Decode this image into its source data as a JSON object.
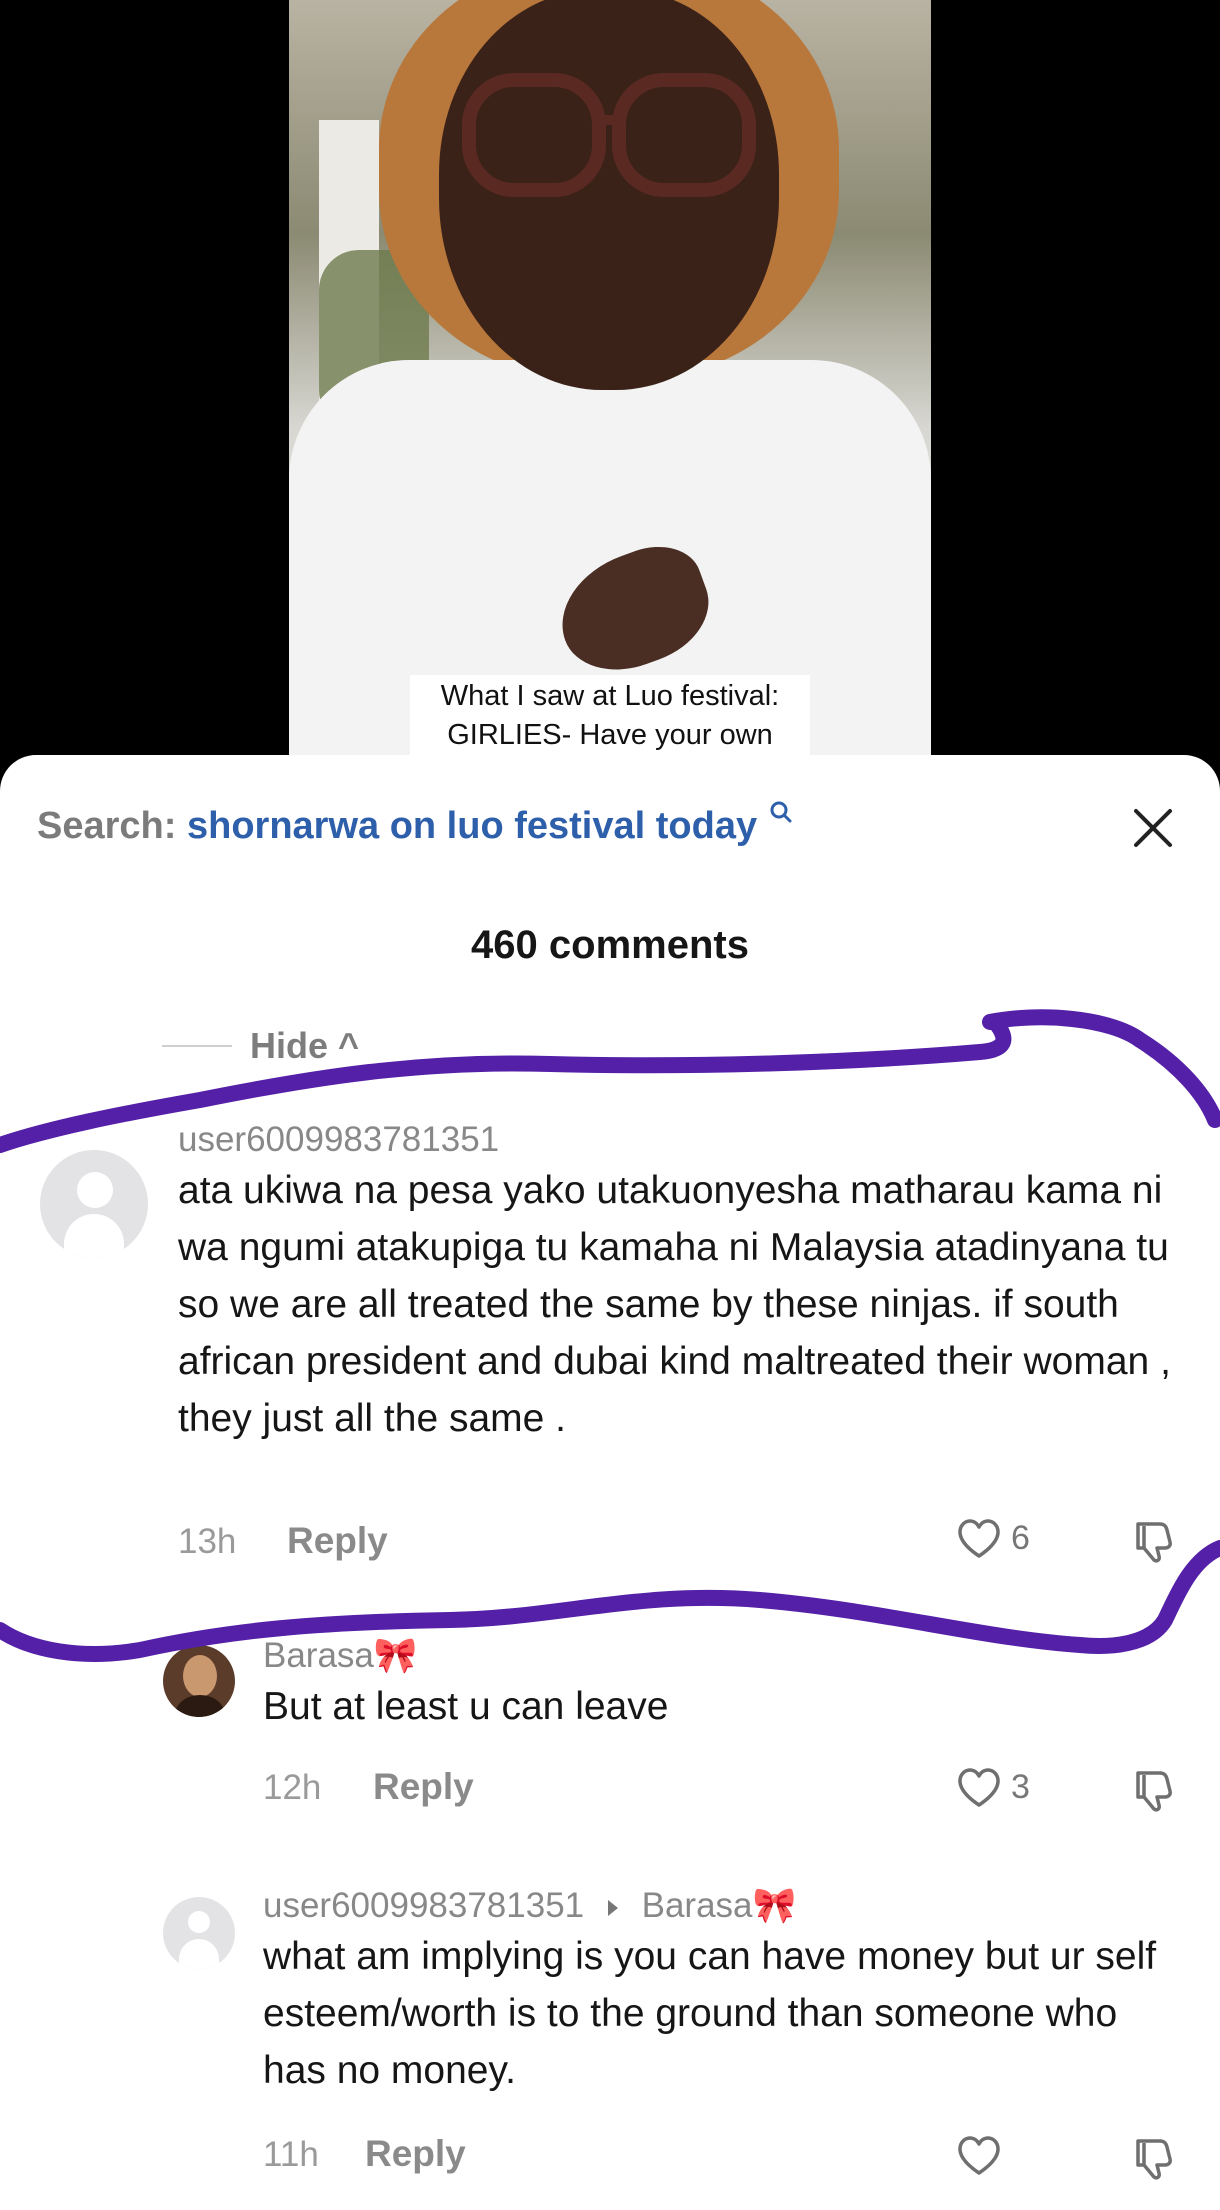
{
  "video": {
    "caption_line1": "What I saw at Luo festival:",
    "caption_line2": "GIRLIES- Have your own"
  },
  "search": {
    "label": "Search:",
    "query": "shornarwa on luo festival today"
  },
  "comments_count": "460 comments",
  "hide_label": "Hide ^",
  "comments": [
    {
      "username": "user6009983781351",
      "text": "ata ukiwa na pesa yako utakuonyesha matharau kama ni wa ngumi atakupiga tu kamaha ni Malaysia atadinyana tu so we are all treated the same by these ninjas. if south african president and dubai kind maltreated their woman , they just all the same .",
      "time": "13h",
      "reply_label": "Reply",
      "likes": "6"
    },
    {
      "username": "Barasa",
      "username_emoji": "🎀",
      "text": "But at least u can leave",
      "time": "12h",
      "reply_label": "Reply",
      "likes": "3"
    },
    {
      "username": "user6009983781351",
      "reply_to": "Barasa",
      "reply_to_emoji": "🎀",
      "text": "what am implying is you can have money but ur self esteem/worth is to the ground than someone who has no money.",
      "time": "11h",
      "reply_label": "Reply",
      "likes": ""
    }
  ],
  "colors": {
    "search_query": "#2e5faa",
    "annotation_stroke": "#5420a8"
  }
}
